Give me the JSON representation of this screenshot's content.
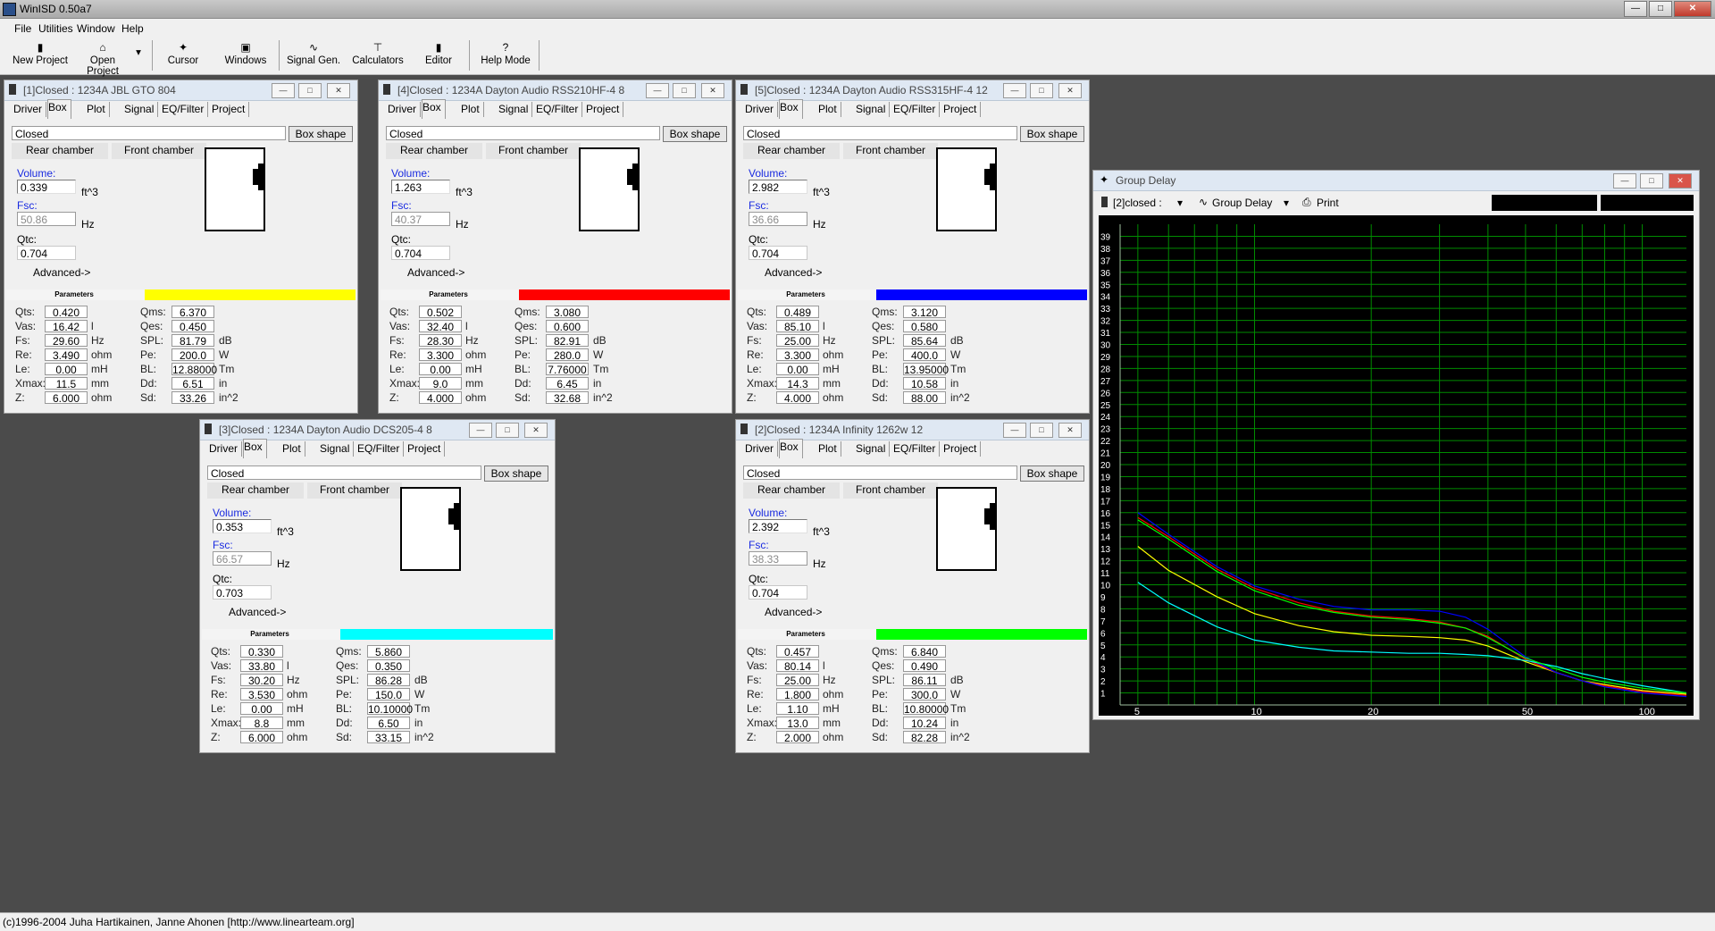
{
  "app": {
    "title": "WinISD 0.50a7"
  },
  "menu": [
    "File",
    "Utilities",
    "Window",
    "Help"
  ],
  "toolbar": [
    {
      "label": "New Project",
      "icon": "new-project-icon"
    },
    {
      "label": "Open Project",
      "icon": "open-project-icon"
    },
    {
      "label": "Cursor",
      "icon": "cursor-icon"
    },
    {
      "label": "Windows",
      "icon": "windows-icon"
    },
    {
      "label": "Signal Gen.",
      "icon": "signal-generator-icon"
    },
    {
      "label": "Calculators",
      "icon": "calculators-icon"
    },
    {
      "label": "Editor",
      "icon": "editor-icon"
    },
    {
      "label": "Help Mode",
      "icon": "help-mode-icon"
    }
  ],
  "tabs": [
    "Driver",
    "Box",
    "Plot",
    "Signal",
    "EQ/Filter",
    "Project"
  ],
  "common": {
    "box_type": "Closed",
    "box_shape_btn": "Box shape",
    "rear_chamber": "Rear chamber",
    "front_chamber": "Front chamber",
    "volume_label": "Volume:",
    "volume_unit": "ft^3",
    "fsc_label": "Fsc:",
    "fsc_unit": "Hz",
    "qtc_label": "Qtc:",
    "advanced": "Advanced->",
    "parameters": "Parameters"
  },
  "param_labels": {
    "left": [
      "Qts:",
      "Vas:",
      "Fs:",
      "Re:",
      "Le:",
      "Xmax:",
      "Z:"
    ],
    "left_units": [
      "",
      "l",
      "Hz",
      "ohm",
      "mH",
      "mm",
      "ohm"
    ],
    "right": [
      "Qms:",
      "Qes:",
      "SPL:",
      "Pe:",
      "BL:",
      "Dd:",
      "Sd:"
    ],
    "right_units": [
      "",
      "",
      "dB",
      "W",
      "Tm",
      "in",
      "in^2"
    ]
  },
  "windows": [
    {
      "title": "[1]Closed : 1234A JBL GTO 804",
      "volume": "0.339",
      "fsc": "50.86",
      "qtc": "0.704",
      "color": "#ffff00",
      "left": [
        "0.420",
        "16.42",
        "29.60",
        "3.490",
        "0.00",
        "11.5",
        "6.000"
      ],
      "right": [
        "6.370",
        "0.450",
        "81.79",
        "200.0",
        "12.88000",
        "6.51",
        "33.26"
      ]
    },
    {
      "title": "[4]Closed : 1234A Dayton Audio RSS210HF-4 8",
      "volume": "1.263",
      "fsc": "40.37",
      "qtc": "0.704",
      "color": "#ff0000",
      "left": [
        "0.502",
        "32.40",
        "28.30",
        "3.300",
        "0.00",
        "9.0",
        "4.000"
      ],
      "right": [
        "3.080",
        "0.600",
        "82.91",
        "280.0",
        "7.76000",
        "6.45",
        "32.68"
      ]
    },
    {
      "title": "[5]Closed : 1234A Dayton Audio RSS315HF-4 12",
      "volume": "2.982",
      "fsc": "36.66",
      "qtc": "0.704",
      "color": "#0000ff",
      "left": [
        "0.489",
        "85.10",
        "25.00",
        "3.300",
        "0.00",
        "14.3",
        "4.000"
      ],
      "right": [
        "3.120",
        "0.580",
        "85.64",
        "400.0",
        "13.95000",
        "10.58",
        "88.00"
      ]
    },
    {
      "title": "[3]Closed : 1234A Dayton Audio DCS205-4 8",
      "volume": "0.353",
      "fsc": "66.57",
      "qtc": "0.703",
      "color": "#00ffff",
      "left": [
        "0.330",
        "33.80",
        "30.20",
        "3.530",
        "0.00",
        "8.8",
        "6.000"
      ],
      "right": [
        "5.860",
        "0.350",
        "86.28",
        "150.0",
        "10.10000",
        "6.50",
        "33.15"
      ]
    },
    {
      "title": "[2]Closed : 1234A Infinity 1262w 12",
      "volume": "2.392",
      "fsc": "38.33",
      "qtc": "0.704",
      "color": "#00ff00",
      "left": [
        "0.457",
        "80.14",
        "25.00",
        "1.800",
        "1.10",
        "13.0",
        "2.000"
      ],
      "right": [
        "6.840",
        "0.490",
        "86.11",
        "300.0",
        "10.80000",
        "10.24",
        "82.28"
      ]
    }
  ],
  "group_delay": {
    "title": "Group Delay",
    "project_select": "[2]closed :",
    "plot_select": "Group Delay",
    "print": "Print"
  },
  "chart_data": {
    "type": "line",
    "title": "",
    "xlabel": "",
    "ylabel": "",
    "x_scale": "log",
    "xlim": [
      4.5,
      130
    ],
    "ylim": [
      0,
      40
    ],
    "x_ticks": [
      5,
      10,
      20,
      50,
      100
    ],
    "y_ticks": [
      1,
      2,
      3,
      4,
      5,
      6,
      7,
      8,
      9,
      10,
      11,
      12,
      13,
      14,
      15,
      16,
      17,
      18,
      19,
      20,
      21,
      22,
      23,
      24,
      25,
      26,
      27,
      28,
      29,
      30,
      31,
      32,
      33,
      34,
      35,
      36,
      37,
      38,
      39
    ],
    "grid": true,
    "background": "#000000",
    "grid_color": "#008c00",
    "series": [
      {
        "color": "#ffff00",
        "x": [
          5,
          6,
          8,
          10,
          13,
          16,
          20,
          25,
          30,
          35,
          40,
          50,
          60,
          70,
          80,
          100,
          130
        ],
        "y": [
          13.2,
          11.2,
          9.0,
          7.6,
          6.6,
          6.1,
          5.8,
          5.7,
          5.6,
          5.4,
          4.9,
          3.6,
          2.7,
          2.0,
          1.7,
          1.2,
          0.9
        ]
      },
      {
        "color": "#ff0000",
        "x": [
          5,
          6,
          8,
          10,
          13,
          16,
          20,
          25,
          30,
          35,
          40,
          50,
          60,
          70,
          80,
          100,
          130
        ],
        "y": [
          15.6,
          14.0,
          11.3,
          9.7,
          8.5,
          7.8,
          7.4,
          7.2,
          6.9,
          6.4,
          5.7,
          3.8,
          2.7,
          2.0,
          1.6,
          1.1,
          0.8
        ]
      },
      {
        "color": "#0000ff",
        "x": [
          5,
          6,
          8,
          10,
          13,
          16,
          20,
          25,
          30,
          35,
          40,
          50,
          60,
          70,
          80,
          100,
          130
        ],
        "y": [
          16.0,
          14.2,
          11.5,
          9.9,
          8.8,
          8.2,
          7.9,
          7.9,
          7.8,
          7.3,
          6.3,
          4.0,
          2.7,
          2.0,
          1.5,
          1.0,
          0.7
        ]
      },
      {
        "color": "#00ffff",
        "x": [
          5,
          6,
          8,
          10,
          13,
          16,
          20,
          25,
          30,
          35,
          40,
          50,
          60,
          70,
          80,
          100,
          130
        ],
        "y": [
          10.2,
          8.5,
          6.5,
          5.4,
          4.8,
          4.5,
          4.4,
          4.3,
          4.3,
          4.2,
          4.1,
          3.7,
          3.2,
          2.6,
          2.2,
          1.6,
          1.0
        ]
      },
      {
        "color": "#00ff00",
        "x": [
          5,
          6,
          8,
          10,
          13,
          16,
          20,
          25,
          30,
          35,
          40,
          50,
          60,
          70,
          80,
          100,
          130
        ],
        "y": [
          15.4,
          13.8,
          11.1,
          9.5,
          8.3,
          7.7,
          7.3,
          7.1,
          6.8,
          6.4,
          5.6,
          3.9,
          3.0,
          2.3,
          1.9,
          1.4,
          1.0
        ]
      }
    ]
  }
}
